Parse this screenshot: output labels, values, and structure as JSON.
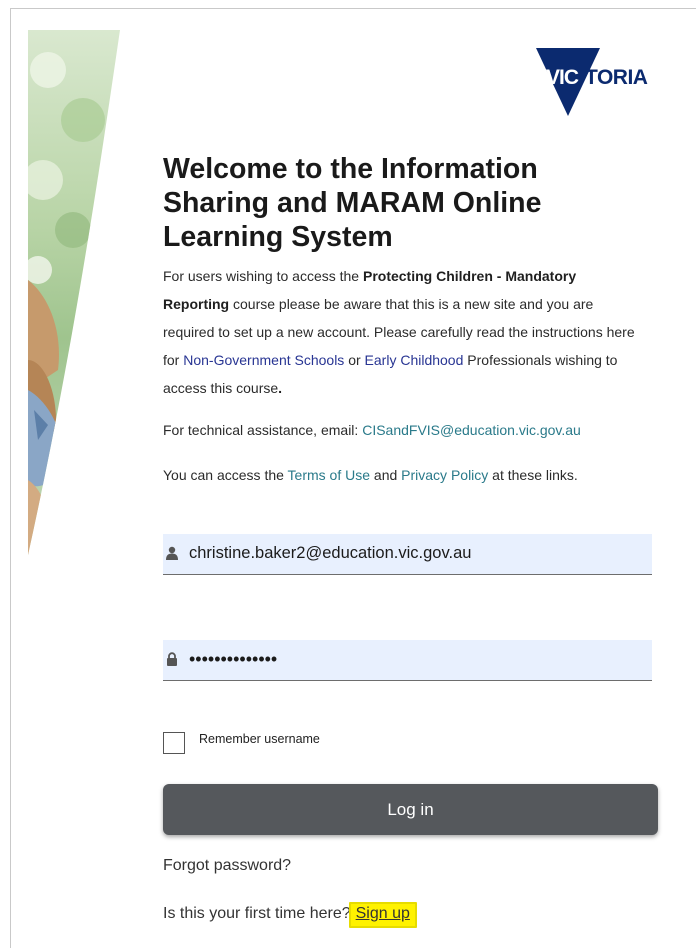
{
  "logo": {
    "text": "VICTORIA"
  },
  "heading": "Welcome to the Information Sharing and MARAM Online Learning System",
  "intro": {
    "t1": "For users wishing to access the ",
    "b1": "Protecting Children - Mandatory Reporting",
    "t2": " course please be aware that this is a new site and you are required to set up a new account. Please carefully read the instructions here for ",
    "link1": "Non-Government Schools",
    "t3": " or ",
    "link2": "Early Childhood",
    "t4": " Professionals wishing to access this course",
    "t5": "."
  },
  "support": {
    "text": "For technical assistance, email: ",
    "email": "CISandFVIS@education.vic.gov.au"
  },
  "terms": {
    "t1": "You can access the ",
    "terms_link": "Terms of Use",
    "t2": " and ",
    "privacy_link": "Privacy Policy",
    "t3": " at these links."
  },
  "login": {
    "username_value": "christine.baker2@education.vic.gov.au",
    "password_value": "••••••••••••••",
    "remember_label": "Remember username",
    "remember_checked": false,
    "button_label": "Log in",
    "forgot_label": "Forgot password?",
    "first_time_text": "Is this your first time here?",
    "signup_label": "Sign up"
  },
  "colors": {
    "button_bg": "#55585c",
    "field_bg": "#e8f0fe",
    "link_blue": "#283593",
    "link_teal": "#2a7a8a",
    "highlight": "#fff200",
    "logo_navy": "#0b2a6f"
  },
  "icons": {
    "username": "user-icon",
    "password": "lock-icon"
  }
}
